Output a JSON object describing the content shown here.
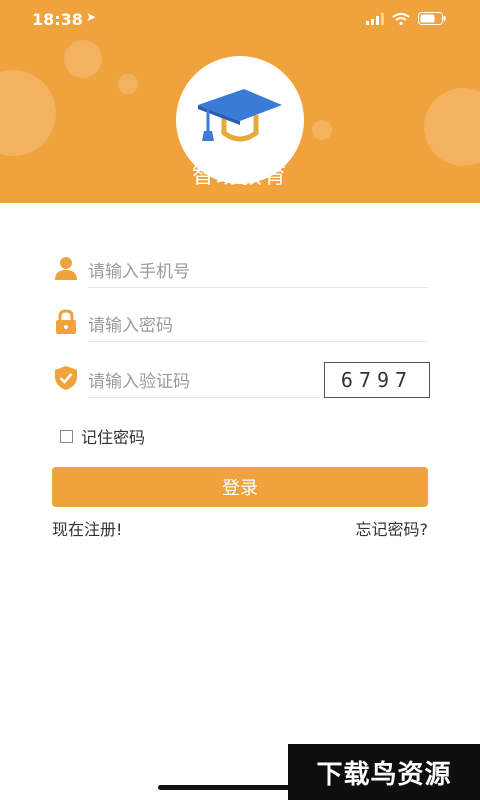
{
  "status_bar": {
    "time": "18:38"
  },
  "app": {
    "title": "智助教育"
  },
  "form": {
    "phone_placeholder": "请输入手机号",
    "password_placeholder": "请输入密码",
    "captcha_placeholder": "请输入验证码",
    "captcha_code": "6797",
    "remember_label": "记住密码",
    "login_label": "登录",
    "register_label": "现在注册!",
    "forgot_label": "忘记密码?"
  },
  "watermark": {
    "text": "下载鸟资源"
  },
  "colors": {
    "accent": "#F0A23C",
    "logo_blue": "#3B7BD8"
  }
}
